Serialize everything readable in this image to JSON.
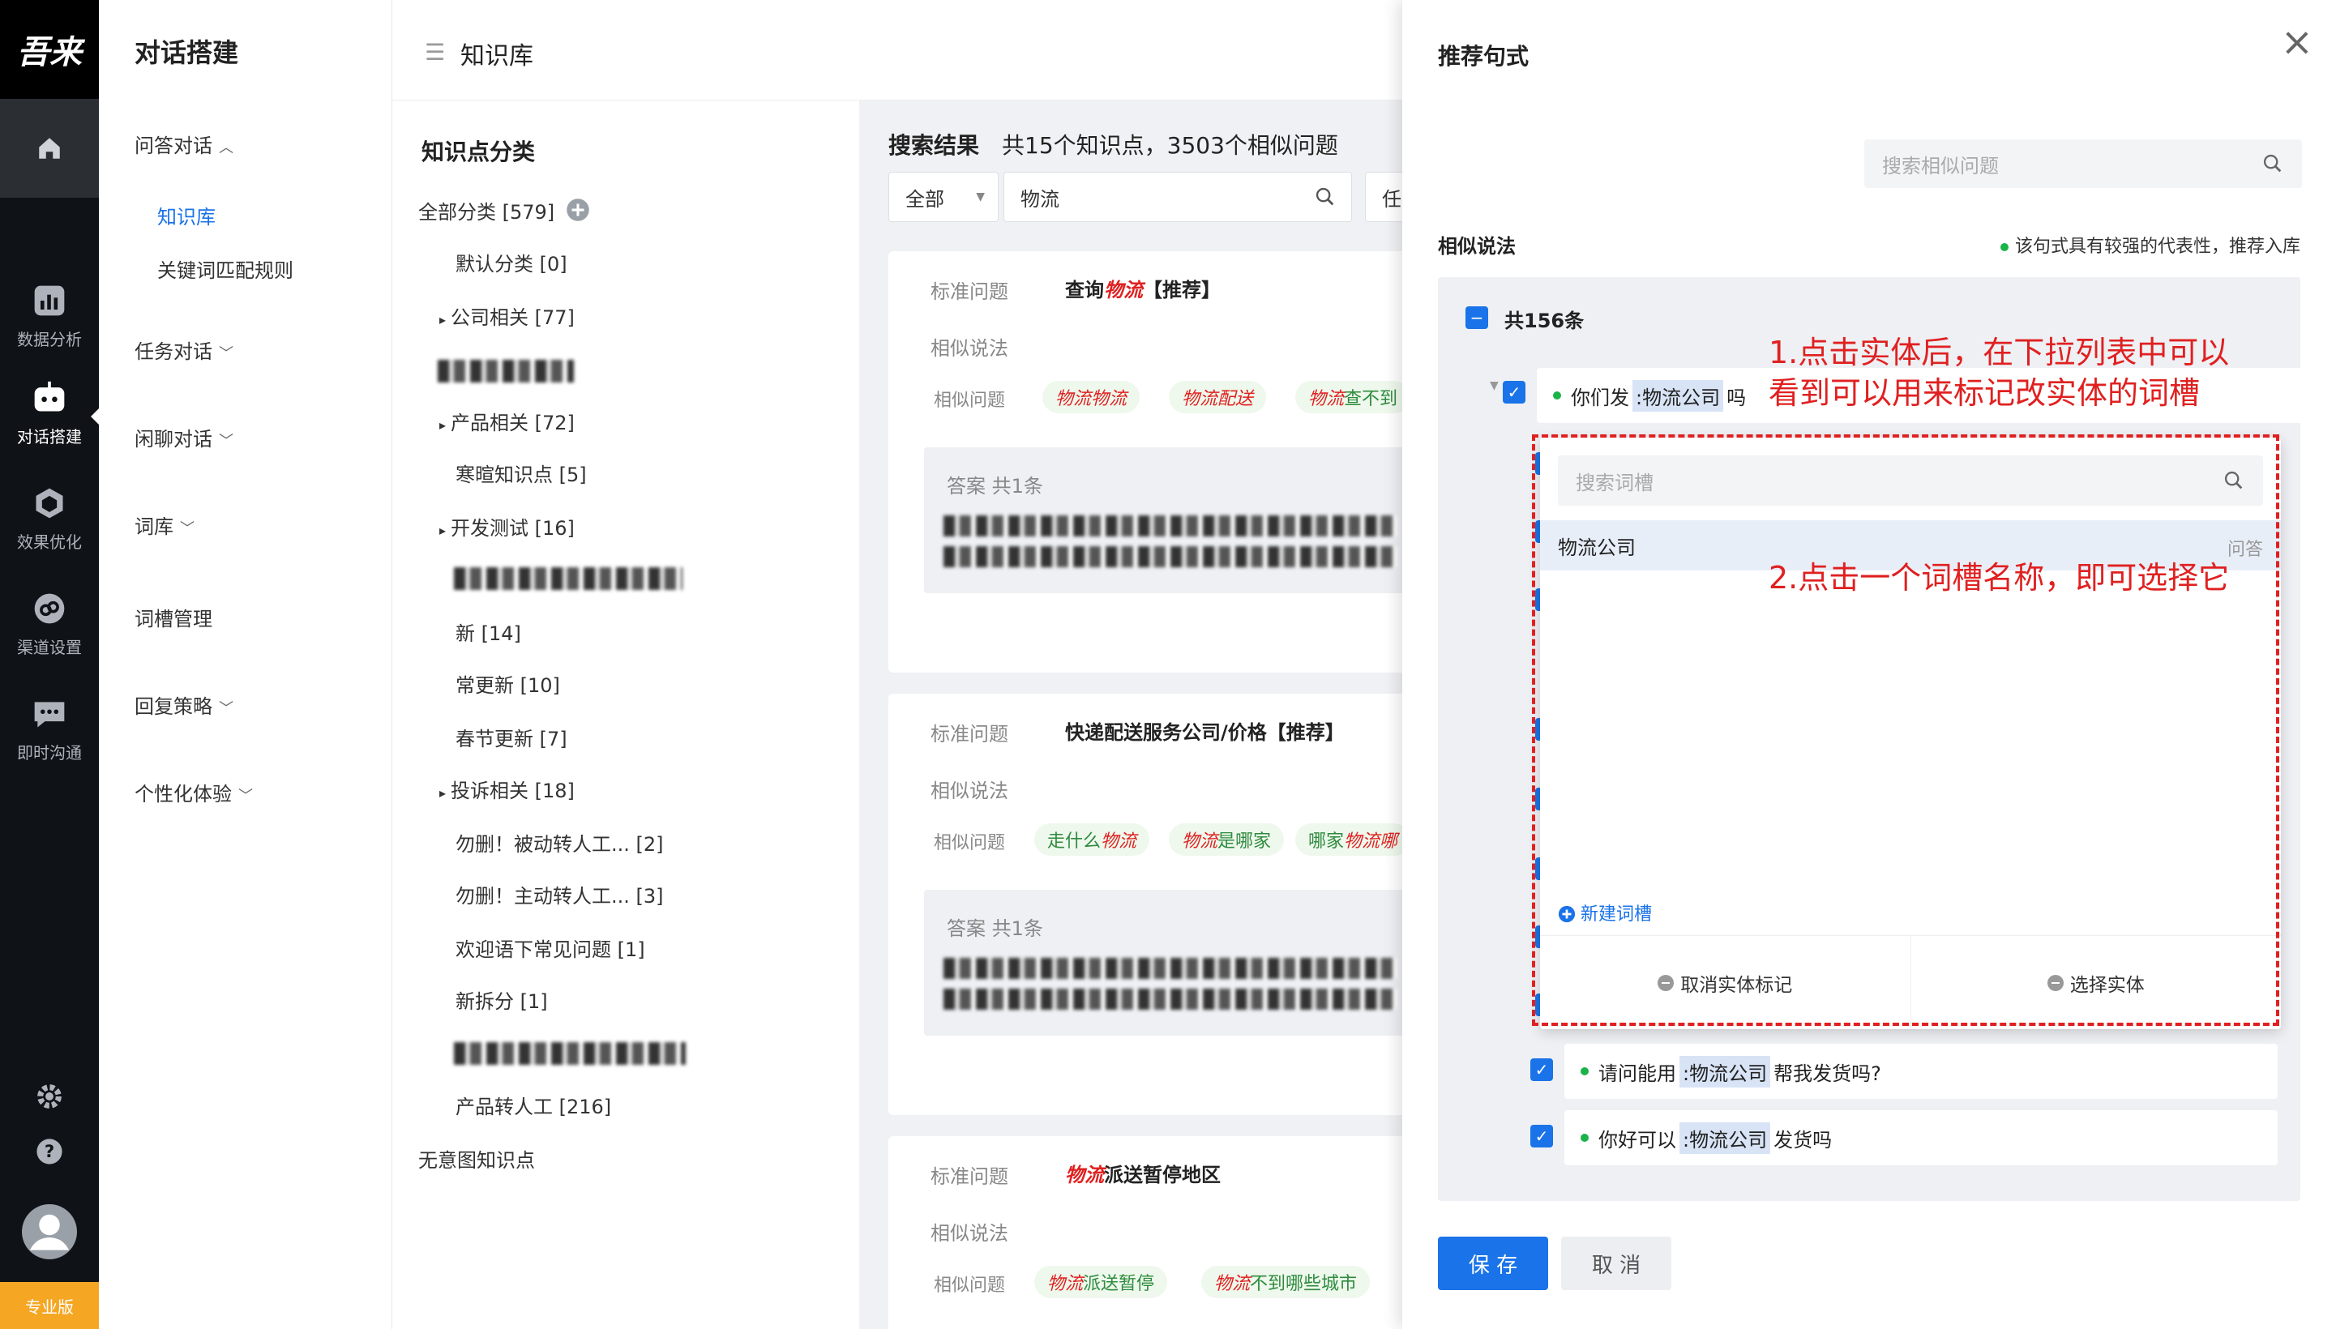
{
  "rail": {
    "logo": "吾来",
    "items": [
      {
        "label": "数据分析",
        "icon": "chart-icon"
      },
      {
        "label": "对话搭建",
        "icon": "robot-icon"
      },
      {
        "label": "效果优化",
        "icon": "cube-icon"
      },
      {
        "label": "渠道设置",
        "icon": "channel-icon"
      },
      {
        "label": "即时沟通",
        "icon": "chat-icon"
      }
    ],
    "edition": "专业版"
  },
  "nav": {
    "title": "对话搭建",
    "qa": "问答对话",
    "kb": "知识库",
    "kw": "关键词匹配规则",
    "task": "任务对话",
    "chat": "闲聊对话",
    "lexicon": "词库",
    "slots": "词槽管理",
    "reply": "回复策略",
    "personal": "个性化体验"
  },
  "header": {
    "title": "知识库"
  },
  "categories": {
    "title": "知识点分类",
    "all": "全部分类 [579]",
    "items": [
      "默认分类 [0]",
      "公司相关 [77]",
      "产品相关 [72]",
      "寒暄知识点 [5]",
      "开发测试 [16]",
      "新 [14]",
      "常更新 [10]",
      "春节更新 [7]",
      "投诉相关 [18]",
      "勿删！被动转人工... [2]",
      "勿删！主动转人工... [3]",
      "欢迎语下常见问题 [1]",
      "新拆分 [1]",
      "产品转人工 [216]"
    ],
    "no_intent": "无意图知识点"
  },
  "results": {
    "title": "搜索结果",
    "summary": "共15个知识点，3503个相似问题",
    "filter": "全部",
    "query": "物流",
    "cut_label": "任",
    "std_label": "标准问题",
    "sim_label": "相似说法",
    "simq_label": "相似问题",
    "ans_label": "答案  共1条",
    "card1": {
      "q_prefix": "查询",
      "q_em": "物流",
      "q_suffix": "【推荐】",
      "tags": [
        [
          "物流物流",
          "",
          ""
        ],
        [
          "物流配送",
          "",
          ""
        ],
        [
          "物流",
          "查不到",
          ""
        ]
      ]
    },
    "card2": {
      "q": "快递配送服务公司/价格【推荐】",
      "tags": [
        [
          "",
          "走什么",
          "物流"
        ],
        [
          "物流",
          "是哪家",
          ""
        ],
        [
          "",
          "哪家",
          "物流哪"
        ]
      ]
    },
    "card3": {
      "q_em": "物流",
      "q_suffix": "派送暂停地区",
      "tags": [
        [
          "物流",
          "派送暂停",
          ""
        ],
        [
          "物流",
          "不到哪些城市",
          ""
        ]
      ]
    }
  },
  "panel": {
    "title": "推荐句式",
    "search_placeholder": "搜索相似问题",
    "sim_title": "相似说法",
    "hint": "该句式具有较强的代表性，推荐入库",
    "total": "共156条",
    "row1": {
      "pre": "你们发",
      "entity": ":物流公司",
      "post": "吗"
    },
    "row2": {
      "pre": "请问能用",
      "entity": ":物流公司",
      "post": "帮我发货吗?"
    },
    "row3": {
      "pre": "你好可以",
      "entity": ":物流公司",
      "post": "发货吗"
    },
    "dropdown": {
      "search_placeholder": "搜索词槽",
      "option": "物流公司",
      "option_src": "问答",
      "new_slot": "新建词槽",
      "cancel_mark": "取消实体标记",
      "select_entity": "选择实体"
    },
    "save": "保 存",
    "cancel": "取 消"
  },
  "annotations": {
    "note1_line1": "1.点击实体后，在下拉列表中可以",
    "note1_line2": "看到可以用来标记改实体的词槽",
    "note2": "2.点击一个词槽名称，即可选择它"
  },
  "colors": {
    "accent": "#1a73e8",
    "annotation": "#e02020",
    "tag_bg": "#eef8ec",
    "tag_text": "#2e8b3e",
    "edition": "#f5a623"
  }
}
